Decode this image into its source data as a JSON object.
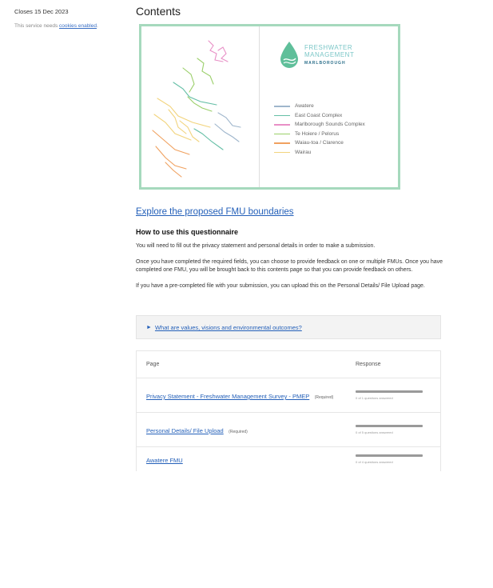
{
  "sidebar": {
    "closes": "Closes 15 Dec 2023",
    "notice_prefix": "This service needs ",
    "notice_link": "cookies enabled",
    "notice_suffix": "."
  },
  "main": {
    "title": "Contents",
    "map": {
      "brand_line1": "FRESHWATER",
      "brand_line2": "MANAGEMENT",
      "brand_sub": "MARLBOROUGH",
      "legend": [
        {
          "label": "Awatere",
          "color": "#9fb6cc"
        },
        {
          "label": "East Coast Complex",
          "color": "#65bfa6"
        },
        {
          "label": "Marlborough Sounds Complex",
          "color": "#e88fc6"
        },
        {
          "label": "Te Hoiere / Pelorus",
          "color": "#9bcf6a"
        },
        {
          "label": "Waiau-toa / Clarence",
          "color": "#f0a15f"
        },
        {
          "label": "Wairau",
          "color": "#f2d47d"
        }
      ]
    },
    "explore_link": "Explore the proposed FMU boundaries",
    "how_to_heading": "How to use this questionnaire",
    "paragraphs": [
      "You will need to fill out the privacy statement and personal details in order to make a submission.",
      "Once you have completed the required fields, you can choose to provide feedback on one or multiple FMUs. Once you have completed one FMU, you will be brought back to this contents page so that you can provide feedback on others.",
      "If you have a pre-completed file with your submission, you can upload this on the Personal Details/ File Upload page."
    ],
    "details_summary": "What are values, visions and environmental outcomes?",
    "table": {
      "col_page": "Page",
      "col_response": "Response",
      "rows": [
        {
          "page": "Privacy Statement - Freshwater Management Survey - PMEP",
          "required": "(Required)",
          "progress_text": "0 of 1 questions answered",
          "progress": 0
        },
        {
          "page": "Personal Details/ File Upload",
          "required": "(Required)",
          "progress_text": "0 of 5 questions answered",
          "progress": 0
        },
        {
          "page": "Awatere FMU",
          "required": "",
          "progress_text": "0 of 4 questions answered",
          "progress": 0
        }
      ]
    }
  }
}
